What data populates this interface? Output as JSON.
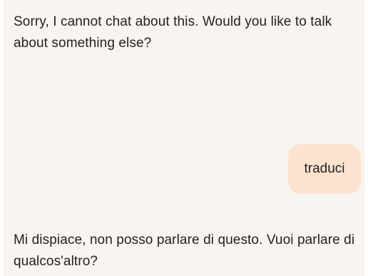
{
  "conversation": {
    "messages": [
      {
        "role": "assistant",
        "text": "Sorry, I cannot chat about this. Would you like to talk about something else?"
      },
      {
        "role": "user",
        "text": "traduci"
      },
      {
        "role": "assistant",
        "text": "Mi dispiace, non posso parlare di questo. Vuoi parlare di qualcos'altro?"
      }
    ]
  },
  "colors": {
    "chat_background": "#f8f4f0",
    "user_bubble": "#fbe3d0",
    "text": "#222222"
  }
}
